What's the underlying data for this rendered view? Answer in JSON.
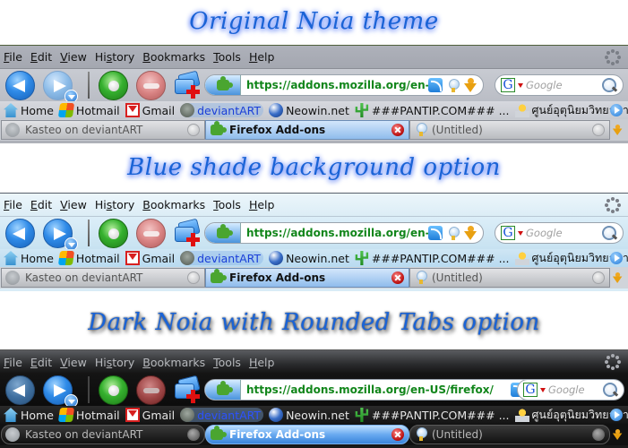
{
  "sections": [
    {
      "title": "Original Noia theme",
      "theme": "original",
      "menu": [
        "File",
        "Edit",
        "View",
        "History",
        "Bookmarks",
        "Tools",
        "Help"
      ],
      "url": "https://addons.mozilla.org/en-US/fire",
      "search_placeholder": "Google",
      "bookmarks": [
        "Home",
        "Hotmail",
        "Gmail",
        "deviantART",
        "Neowin.net",
        "###PANTIP.COM### ...",
        "ศูนย์อุตุนิยมวิทยาภาคเหนือ"
      ],
      "tabs": [
        {
          "label": "Kasteo on deviantART",
          "active": false
        },
        {
          "label": "Firefox Add-ons",
          "active": true
        },
        {
          "label": "(Untitled)",
          "active": false
        }
      ]
    },
    {
      "title": "Blue shade background option",
      "theme": "blue",
      "menu": [
        "File",
        "Edit",
        "View",
        "History",
        "Bookmarks",
        "Tools",
        "Help"
      ],
      "url": "https://addons.mozilla.org/en-US/fire",
      "search_placeholder": "Google",
      "bookmarks": [
        "Home",
        "Hotmail",
        "Gmail",
        "deviantART",
        "Neowin.net",
        "###PANTIP.COM### ...",
        "ศูนย์อุตุนิยมวิทยาภาคเหนือ"
      ],
      "tabs": [
        {
          "label": "Kasteo on deviantART",
          "active": false
        },
        {
          "label": "Firefox Add-ons",
          "active": true
        },
        {
          "label": "(Untitled)",
          "active": false
        }
      ]
    },
    {
      "title": "Dark Noia with Rounded Tabs option",
      "theme": "dark",
      "menu": [
        "File",
        "Edit",
        "View",
        "History",
        "Bookmarks",
        "Tools",
        "Help"
      ],
      "url": "https://addons.mozilla.org/en-US/firefox/",
      "search_placeholder": "Google",
      "bookmarks": [
        "Home",
        "Hotmail",
        "Gmail",
        "deviantART",
        "Neowin.net",
        "###PANTIP.COM### ...",
        "ศูนย์อุตุนิยมวิทยาภาคเหนือ"
      ],
      "tabs": [
        {
          "label": "Kasteo on deviantART",
          "active": false
        },
        {
          "label": "Firefox Add-ons",
          "active": true
        },
        {
          "label": "(Untitled)",
          "active": false
        }
      ]
    }
  ],
  "menu_accesskeys": [
    "F",
    "E",
    "V",
    "s",
    "B",
    "T",
    "H"
  ],
  "colors": {
    "title_text": "#1a63d6",
    "url_text": "#12861b",
    "original_chrome": "#aeb1b9",
    "blue_chrome": "#d9ecf6",
    "dark_chrome": "#1a1a1a",
    "active_tab": "#8fbcec"
  }
}
